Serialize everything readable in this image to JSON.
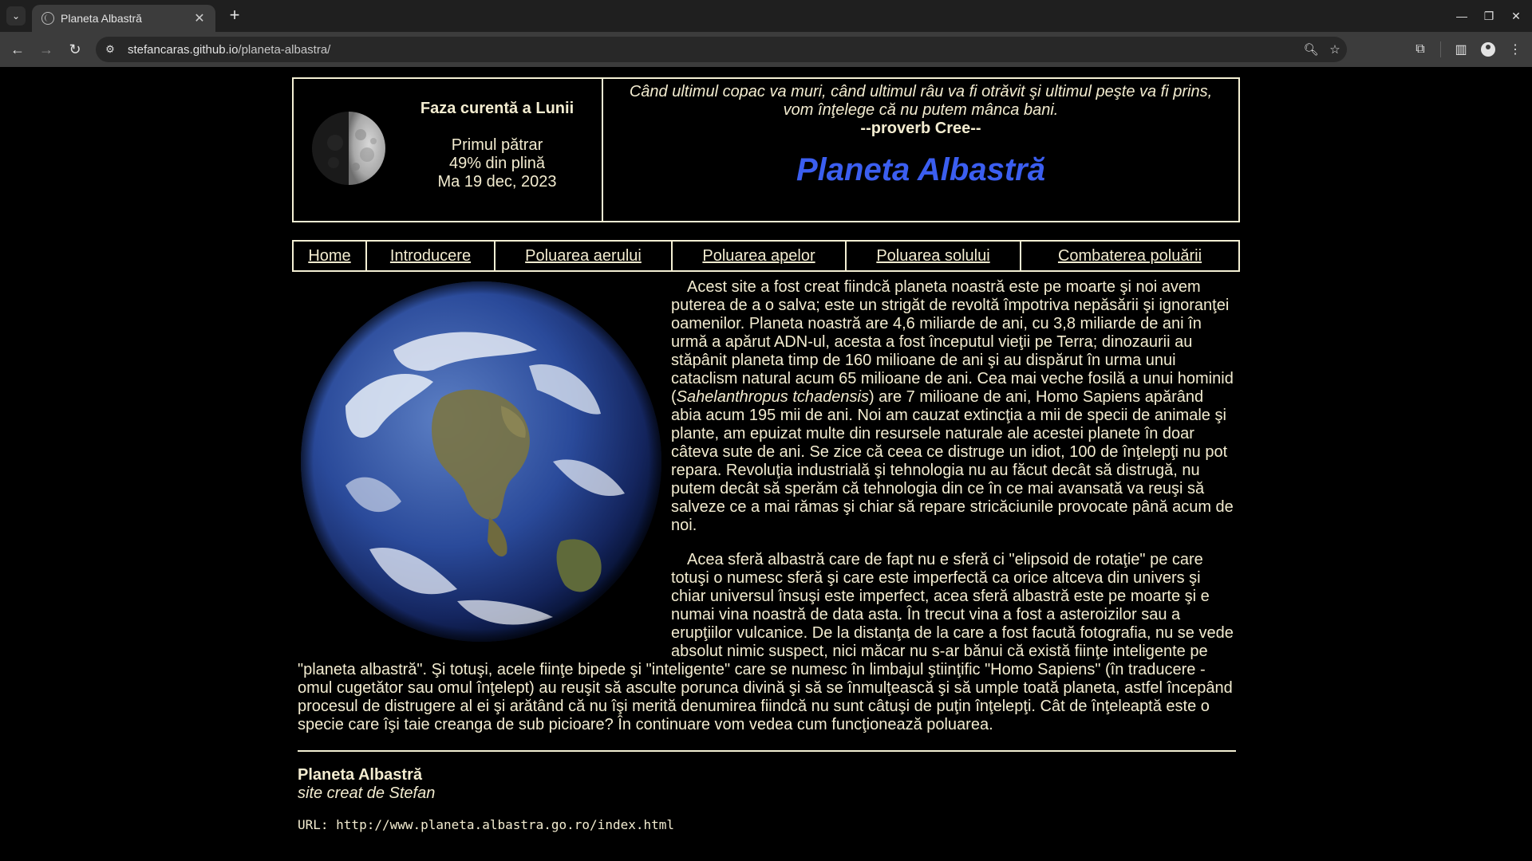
{
  "browser": {
    "tab_title": "Planeta Albastră",
    "url_host": "stefancaras.github.io",
    "url_path": "/planeta-albastra/"
  },
  "moon": {
    "title": "Faza curentă a Lunii",
    "phase": "Primul pătrar",
    "illumination": "49% din plină",
    "date": "Ma 19 dec, 2023"
  },
  "quote": {
    "line1": "Când ultimul copac va muri, când ultimul râu va fi otrăvit şi ultimul peşte va fi prins,",
    "line2": "vom înţelege că nu putem mânca bani.",
    "author": "--proverb Cree--"
  },
  "site_title": "Planeta Albastră",
  "nav": [
    {
      "label": "Home"
    },
    {
      "label": "Introducere"
    },
    {
      "label": "Poluarea aerului"
    },
    {
      "label": "Poluarea apelor"
    },
    {
      "label": "Poluarea solului"
    },
    {
      "label": "Combaterea poluării"
    }
  ],
  "content": {
    "p1_before": "Acest site a fost creat fiindcă planeta noastră este pe moarte şi noi avem puterea de a o salva; este un strigăt de revoltă împotriva nepăsării şi ignoranţei oamenilor. Planeta noastră are 4,6 miliarde de ani, cu 3,8 miliarde de ani în urmă a apărut ADN-ul, acesta a fost începutul vieţii pe Terra; dinozaurii au stăpânit planeta timp de 160 milioane de ani şi au dispărut în urma unui cataclism natural acum 65 milioane de ani. Cea mai veche fosilă a unui hominid (",
    "p1_italic": "Sahelanthropus tchadensis",
    "p1_after": ") are 7 milioane de ani, Homo Sapiens apărând abia acum 195 mii de ani. Noi am cauzat extincţia a mii de specii de animale şi plante, am epuizat multe din resursele naturale ale acestei planete în doar câteva sute de ani. Se zice că ceea ce distruge un idiot, 100 de înţelepţi nu pot repara. Revoluţia industrială şi tehnologia nu au făcut decât să distrugă, nu putem decât să sperăm că tehnologia din ce în ce mai avansată va reuşi să salveze ce a mai rămas şi chiar să repare stricăciunile provocate până acum de noi.",
    "p2": "Acea sferă albastră care de fapt nu e sferă ci \"elipsoid de rotaţie\" pe care totuşi o numesc sferă şi care este imperfectă ca orice altceva din univers şi chiar universul însuşi este imperfect, acea sferă albastră este pe moarte şi e numai vina noastră de data asta. În trecut vina a fost a asteroizilor sau a erupţiilor vulcanice. De la distanţa de la care a fost facută fotografia, nu se vede absolut nimic suspect, nici măcar nu s-ar bănui că există fiinţe inteligente pe \"planeta albastră\". Şi totuşi, acele fiinţe bipede şi \"inteligente\" care se numesc în limbajul ştiinţific \"Homo Sapiens\" (în traducere - omul cugetător sau omul înţelept) au reuşit să asculte porunca divină şi să se înmulţească şi să umple toată planeta, astfel începând procesul de distrugere al ei şi arătând că nu îşi merită denumirea fiindcă nu sunt câtuşi de puţin înţelepţi. Cât de înţeleaptă este o specie care îşi taie creanga de sub picioare? În continuare vom vedea cum funcţionează poluarea."
  },
  "footer": {
    "title": "Planeta Albastră",
    "subtitle": "site creat de Stefan",
    "url": "URL: http://www.planeta.albastra.go.ro/index.html"
  }
}
